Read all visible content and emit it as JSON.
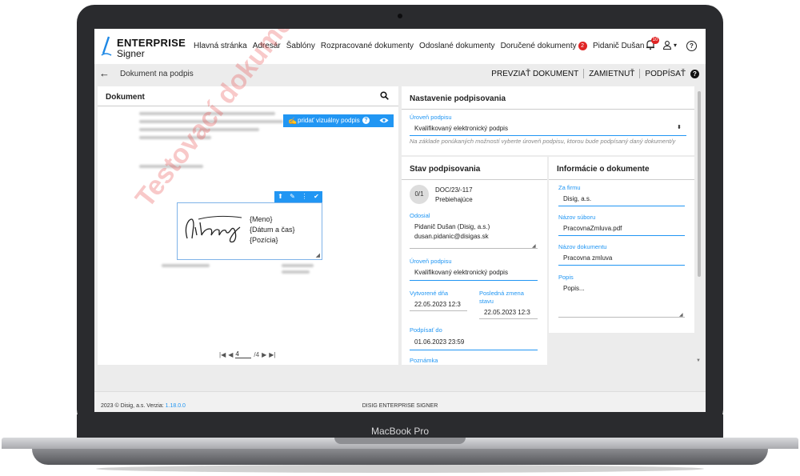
{
  "device": {
    "label": "MacBook Pro"
  },
  "logo": {
    "line1": "ENTERPRISE",
    "line2": "Signer"
  },
  "nav": {
    "items": [
      "Hlavná stránka",
      "Adresár",
      "Šablóny",
      "Rozpracované dokumenty",
      "Odoslané dokumenty",
      "Doručené dokumenty"
    ],
    "received_badge": "2"
  },
  "user": {
    "name": "Pidanič Dušan",
    "bell_badge": "10",
    "caret": "▾",
    "help": "?"
  },
  "toolbar": {
    "back": "←",
    "title": "Dokument na podpis",
    "preview": "PREVZIAŤ DOKUMENT",
    "reject": "ZAMIETNUŤ",
    "sign": "PODPÍSAŤ",
    "help": "?"
  },
  "document": {
    "title": "Dokument",
    "watermark": "Testovací dokument",
    "visual_sign_button": "pridať vizuálny podpis",
    "visual_help": "?",
    "sig_tools": [
      "⬆",
      "✎",
      "⋮",
      "✔"
    ],
    "signature_fields": [
      "{Meno}",
      "{Dátum a čas}",
      "{Pozícia}"
    ],
    "pager": {
      "current": "4",
      "total": "/4"
    }
  },
  "settings": {
    "title": "Nastavenie podpisovania",
    "level_label": "Úroveň podpisu",
    "level_value": "Kvalifikovaný elektronický podpis",
    "hint": "Na základe ponúkaných možností vyberte úroveň podpisu, ktorou bude podpísaný daný dokument/y"
  },
  "status": {
    "title": "Stav podpisovania",
    "progress": "0/1",
    "doc_number": "DOC/23/-117",
    "state": "Prebiehajúce",
    "sender_label": "Odosial",
    "sender_name": "Pidanič Dušan (Disig, a.s.)",
    "sender_email": "dusan.pidanic@disigas.sk",
    "level_label": "Úroveň podpisu",
    "level_value": "Kvalifikovaný elektronický podpis",
    "created_label": "Vytvorené dňa",
    "created_value": "22.05.2023 12:3",
    "changed_label": "Posledná zmena stavu",
    "changed_value": "22.05.2023 12:3",
    "sign_by_label": "Podpísať do",
    "sign_by_value": "01.06.2023 23:59",
    "note_label": "Poznámka"
  },
  "info": {
    "title": "Informácie o dokumente",
    "company_label": "Za firmu",
    "company_value": "Disig, a.s.",
    "file_label": "Názov súboru",
    "file_value": "PracovnaZmluva.pdf",
    "docname_label": "Názov dokumentu",
    "docname_value": "Pracovna zmluva",
    "desc_label": "Popis",
    "desc_value": "Popis..."
  },
  "footer": {
    "copyright": "2023 © Disig, a.s.  Verzia: ",
    "version": "1.18.0.0",
    "center": "DISIG ENTERPRISE SIGNER"
  },
  "colors": {
    "accent": "#2196f3",
    "badge": "#e02424",
    "watermark": "#e63c3c"
  }
}
